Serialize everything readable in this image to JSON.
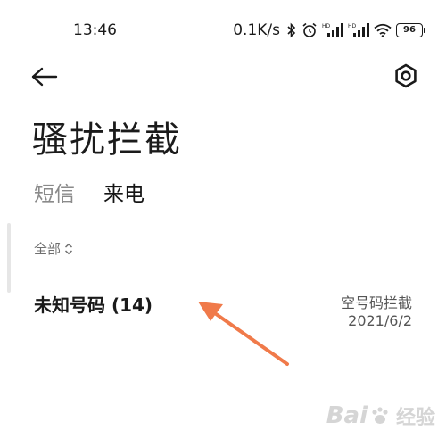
{
  "status_bar": {
    "time": "13:46",
    "net_speed": "0.1K/s",
    "battery": "96"
  },
  "header": {
    "back_icon": "arrow-left-icon",
    "settings_icon": "hexagon-gear-icon"
  },
  "page": {
    "title": "骚扰拦截"
  },
  "tabs": [
    {
      "label": "短信",
      "active": false
    },
    {
      "label": "来电",
      "active": true
    }
  ],
  "filter": {
    "label": "全部"
  },
  "list": [
    {
      "title": "未知号码 (14)",
      "category": "空号码拦截",
      "date": "2021/6/2"
    }
  ],
  "colors": {
    "arrow": "#f07a4a",
    "text_primary": "#1a1a1a",
    "text_muted": "#8a8a8a"
  },
  "watermark": {
    "brand": "Bai",
    "sub": "经验"
  }
}
